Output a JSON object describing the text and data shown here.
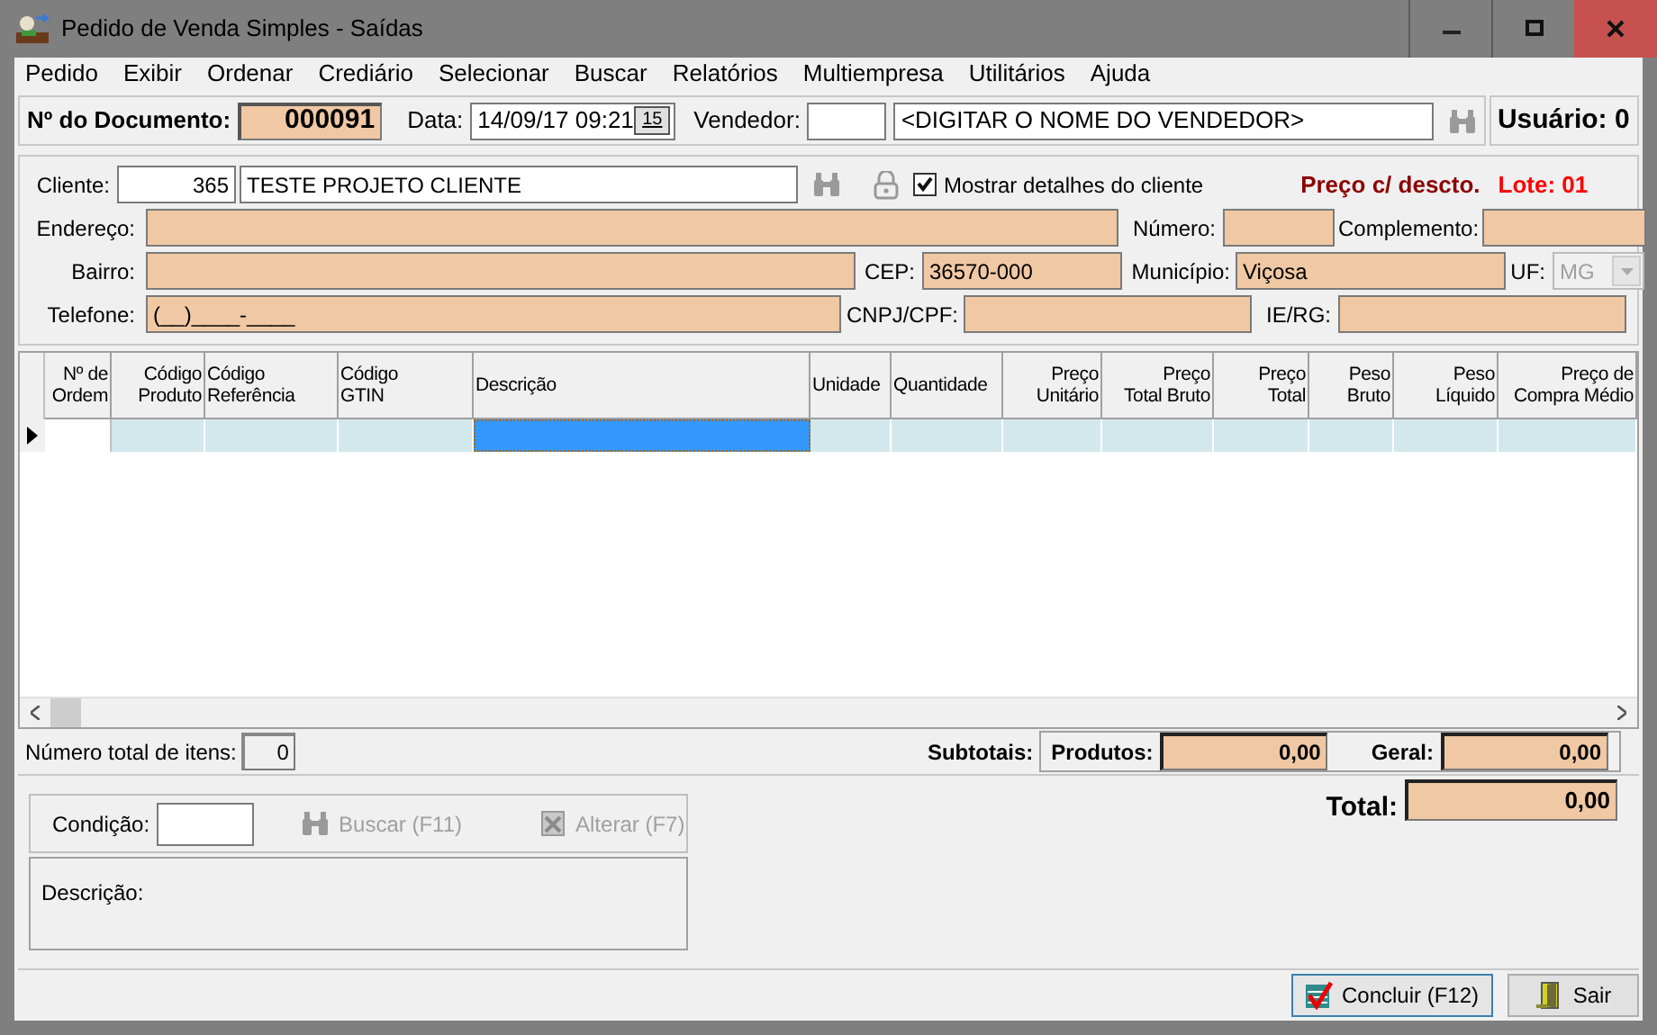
{
  "window": {
    "title": "Pedido de Venda Simples - Saídas"
  },
  "menu": [
    "Pedido",
    "Exibir",
    "Ordenar",
    "Crediário",
    "Selecionar",
    "Buscar",
    "Relatórios",
    "Multiempresa",
    "Utilitários",
    "Ajuda"
  ],
  "document": {
    "number_label": "Nº do Documento:",
    "number": "000091",
    "date_label": "Data:",
    "date": "14/09/17 09:21",
    "calendar_glyph": "15",
    "seller_label": "Vendedor:",
    "seller_name": "<DIGITAR O NOME DO VENDEDOR>",
    "user": "Usuário: 0"
  },
  "customer": {
    "label": "Cliente:",
    "code": "365",
    "name": "TESTE PROJETO CLIENTE",
    "show_details": {
      "label": "Mostrar detalhes do cliente",
      "checked": true
    },
    "price_mode": "Preço c/ descto.",
    "batch": "Lote: 01",
    "address_label": "Endereço:",
    "number_label": "Número:",
    "complement_label": "Complemento:",
    "district_label": "Bairro:",
    "cep_label": "CEP:",
    "cep": "36570-000",
    "city_label": "Município:",
    "city": "Viçosa",
    "uf": {
      "label": "UF:",
      "value": "MG",
      "disabled": true
    },
    "phone_label": "Telefone:",
    "phone": "(__)____-____",
    "cnpj_label": "CNPJ/CPF:",
    "ie_label": "IE/RG:"
  },
  "table": {
    "columns": [
      {
        "label": "Nº de\nOrdem",
        "kind": "numeric",
        "selected": false
      },
      {
        "label": "Código\nProduto",
        "kind": "numeric",
        "selected": false
      },
      {
        "label": "Código\nReferência",
        "kind": "text",
        "selected": false
      },
      {
        "label": "Código\nGTIN",
        "kind": "text",
        "selected": false
      },
      {
        "label": "Descrição",
        "kind": "text",
        "selected": true
      },
      {
        "label": "Unidade",
        "kind": "text",
        "selected": false
      },
      {
        "label": "Quantidade",
        "kind": "text",
        "selected": false
      },
      {
        "label": "Preço\nUnitário",
        "kind": "numeric",
        "selected": false
      },
      {
        "label": "Preço\nTotal Bruto",
        "kind": "numeric",
        "selected": false
      },
      {
        "label": "Preço\nTotal",
        "kind": "numeric",
        "selected": false
      },
      {
        "label": "Peso\nBruto",
        "kind": "numeric",
        "selected": false
      },
      {
        "label": "Peso\nLíquido",
        "kind": "numeric",
        "selected": false
      },
      {
        "label": "Preço de\nCompra Médio",
        "kind": "numeric",
        "selected": false
      }
    ],
    "rows": [
      {
        "current": true
      }
    ]
  },
  "totals": {
    "items_label": "Número total de itens:",
    "items_count": "0",
    "subtotals_label": "Subtotais:",
    "products_label": "Produtos:",
    "products_value": "0,00",
    "general_label": "Geral:",
    "general_value": "0,00",
    "total_label": "Total:",
    "total_value": "0,00"
  },
  "payment": {
    "condition_label": "Condição:",
    "search_button": {
      "label": "Buscar (F11)",
      "disabled": true
    },
    "change_button": {
      "label": "Alterar (F7)",
      "disabled": true
    },
    "description_label": "Descrição:"
  },
  "buttons": [
    {
      "label": "Concluir (F12)",
      "kind": "confirm",
      "default": true
    },
    {
      "label": "Sair",
      "kind": "exit",
      "default": false
    }
  ]
}
